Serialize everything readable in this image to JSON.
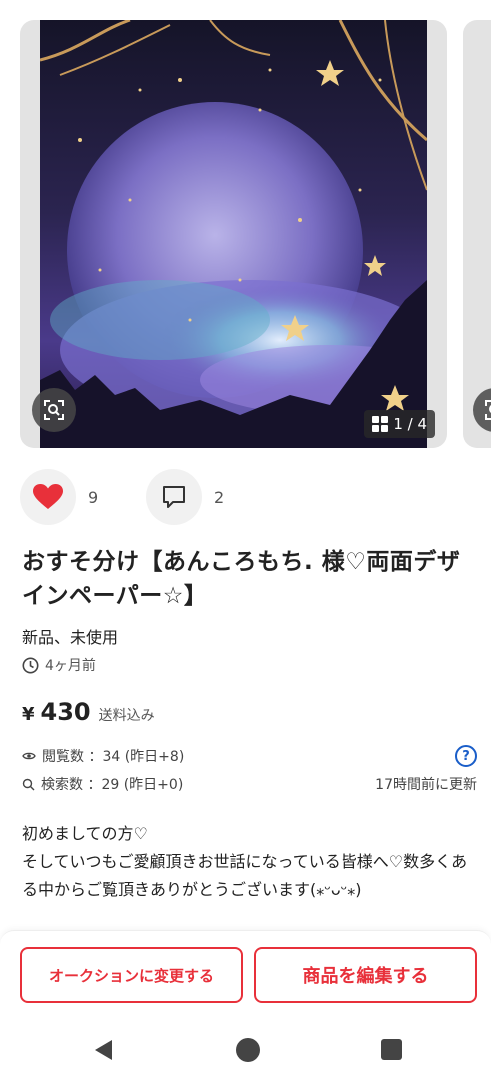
{
  "carousel": {
    "counter": "1 / 4",
    "lens_icon": "image-search-icon",
    "grid_icon": "grid-icon"
  },
  "reactions": {
    "likes": "9",
    "comments": "2",
    "like_color": "#e8303a"
  },
  "item": {
    "title": "おすそ分け【あんころもち. 様♡両面デザインペーパー☆】",
    "condition": "新品、未使用",
    "posted": "4ヶ月前",
    "price_symbol": "¥",
    "price": "430",
    "shipping": "送料込み"
  },
  "stats": {
    "views": "閲覧数 ：34 (昨日+8)",
    "searches": "検索数 ：29 (昨日+0)",
    "updated": "17時間前に更新",
    "help": "?"
  },
  "description": "初めましての方♡\nそしていつもご愛顧頂きお世話になっている皆様へ♡数多くある中からご覧頂きありがとうございます(⁎ᵕᴗᵕ⁎)",
  "actions": {
    "auction_label": "オークションに変更する",
    "edit_label": "商品を編集する",
    "accent_color": "#e8303a"
  }
}
